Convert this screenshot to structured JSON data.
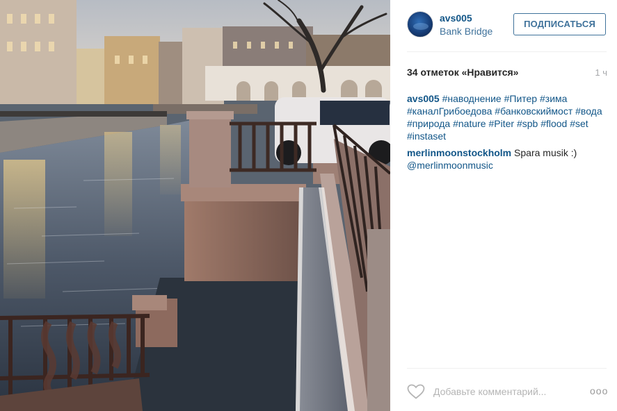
{
  "post": {
    "username": "avs005",
    "location": "Bank Bridge",
    "follow_label": "ПОДПИСАТЬСЯ",
    "likes": "34 отметок «Нравится»",
    "time_ago": "1 ч",
    "caption_user": "avs005",
    "caption_tags": [
      "#наводнение",
      "#Питер",
      "#зима",
      "#каналГрибоедова",
      "#банковскиймост",
      "#вода",
      "#природа",
      "#nature",
      "#Piter",
      "#spb",
      "#flood",
      "#set",
      "#instaset"
    ],
    "comment": {
      "user": "merlinmoonstockholm",
      "text": "Spara musik :)",
      "mention": "@merlinmoonmusic"
    },
    "add_comment_placeholder": "Добавьте комментарий...",
    "more_label": "ooo"
  },
  "colors": {
    "link": "#125688",
    "link_light": "#3f729b",
    "text": "#262626",
    "muted": "#a5a7aa"
  },
  "icons": [
    "heart-icon",
    "more-options-icon"
  ]
}
